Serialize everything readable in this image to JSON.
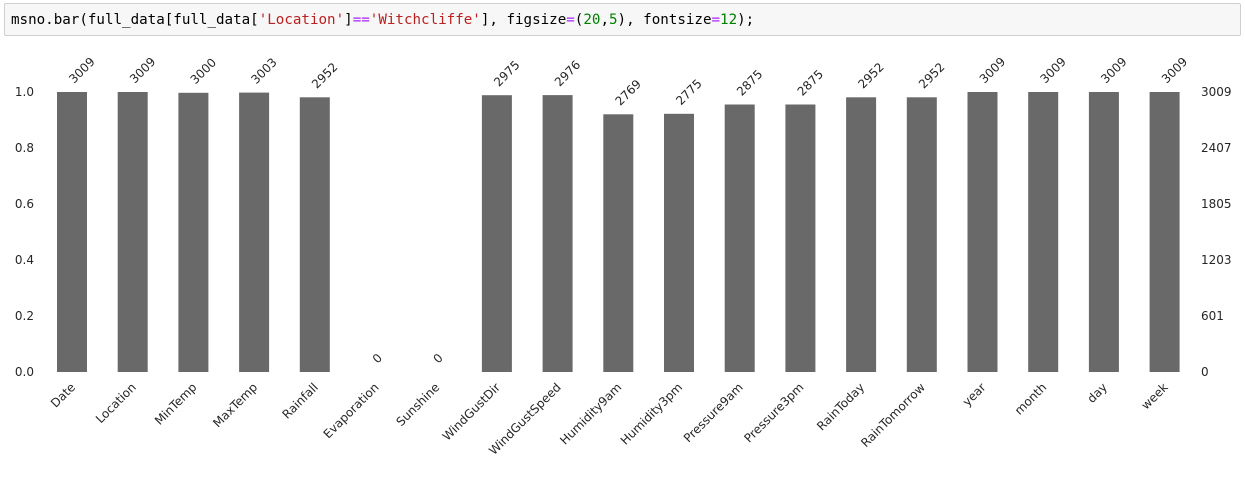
{
  "code": {
    "tokens": [
      {
        "text": "msno.bar(full_data[full_data[",
        "kind": "plain"
      },
      {
        "text": "'Location'",
        "kind": "str"
      },
      {
        "text": "]",
        "kind": "plain"
      },
      {
        "text": "==",
        "kind": "op"
      },
      {
        "text": "'Witchcliffe'",
        "kind": "str"
      },
      {
        "text": "], figsize",
        "kind": "plain"
      },
      {
        "text": "=",
        "kind": "op"
      },
      {
        "text": "(",
        "kind": "plain"
      },
      {
        "text": "20",
        "kind": "num"
      },
      {
        "text": ",",
        "kind": "plain"
      },
      {
        "text": "5",
        "kind": "num"
      },
      {
        "text": "), fontsize",
        "kind": "plain"
      },
      {
        "text": "=",
        "kind": "op"
      },
      {
        "text": "12",
        "kind": "num"
      },
      {
        "text": ");",
        "kind": "plain"
      }
    ]
  },
  "chart_data": {
    "type": "bar",
    "title": "",
    "xlabel": "",
    "ylabel": "",
    "categories": [
      "Date",
      "Location",
      "MinTemp",
      "MaxTemp",
      "Rainfall",
      "Evaporation",
      "Sunshine",
      "WindGustDir",
      "WindGustSpeed",
      "Humidity9am",
      "Humidity3pm",
      "Pressure9am",
      "Pressure3pm",
      "RainToday",
      "RainTomorrow",
      "year",
      "month",
      "day",
      "week"
    ],
    "counts": [
      3009,
      3009,
      3000,
      3003,
      2952,
      0,
      0,
      2975,
      2976,
      2769,
      2775,
      2875,
      2875,
      2952,
      2952,
      3009,
      3009,
      3009,
      3009
    ],
    "count_labels": [
      "3009",
      "3009",
      "3000",
      "3003",
      "2952",
      "0",
      "0",
      "2975",
      "2976",
      "2769",
      "2775",
      "2875",
      "2875",
      "2952",
      "2952",
      "3009",
      "3009",
      "3009",
      "3009"
    ],
    "total": 3009,
    "ylim": [
      0,
      1
    ],
    "left_ticks": [
      "0.0",
      "0.2",
      "0.4",
      "0.6",
      "0.8",
      "1.0"
    ],
    "right_ticks": [
      "0",
      "601",
      "1203",
      "1805",
      "2407",
      "3009"
    ],
    "bar_color": "#696969",
    "grid": false,
    "legend": "none"
  }
}
